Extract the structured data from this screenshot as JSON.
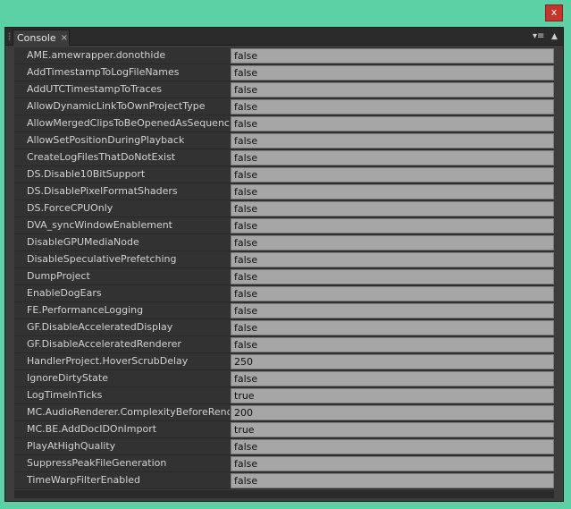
{
  "window": {
    "close_label": "x"
  },
  "panel": {
    "tab_label": "Console",
    "tab_close": "×",
    "menu_icon": "▾≡",
    "scroll_icon": "▲"
  },
  "settings": [
    {
      "name": "AME.amewrapper.donothide",
      "value": "false"
    },
    {
      "name": "AddTimestampToLogFileNames",
      "value": "false"
    },
    {
      "name": "AddUTCTimestampToTraces",
      "value": "false"
    },
    {
      "name": "AllowDynamicLinkToOwnProjectType",
      "value": "false"
    },
    {
      "name": "AllowMergedClipsToBeOpenedAsSequences",
      "value": "false"
    },
    {
      "name": "AllowSetPositionDuringPlayback",
      "value": "false"
    },
    {
      "name": "CreateLogFilesThatDoNotExist",
      "value": "false"
    },
    {
      "name": "DS.Disable10BitSupport",
      "value": "false"
    },
    {
      "name": "DS.DisablePixelFormatShaders",
      "value": "false"
    },
    {
      "name": "DS.ForceCPUOnly",
      "value": "false"
    },
    {
      "name": "DVA_syncWindowEnablement",
      "value": "false"
    },
    {
      "name": "DisableGPUMediaNode",
      "value": "false"
    },
    {
      "name": "DisableSpeculativePrefetching",
      "value": "false"
    },
    {
      "name": "DumpProject",
      "value": "false"
    },
    {
      "name": "EnableDogEars",
      "value": "false"
    },
    {
      "name": "FE.PerformanceLogging",
      "value": "false"
    },
    {
      "name": "GF.DisableAcceleratedDisplay",
      "value": "false"
    },
    {
      "name": "GF.DisableAcceleratedRenderer",
      "value": "false"
    },
    {
      "name": "HandlerProject.HoverScrubDelay",
      "value": "250"
    },
    {
      "name": "IgnoreDirtyState",
      "value": "false"
    },
    {
      "name": "LogTimeInTicks",
      "value": "true"
    },
    {
      "name": "MC.AudioRenderer.ComplexityBeforeRender",
      "value": "200"
    },
    {
      "name": "MC.BE.AddDocIDOnImport",
      "value": "true"
    },
    {
      "name": "PlayAtHighQuality",
      "value": "false"
    },
    {
      "name": "SuppressPeakFileGeneration",
      "value": "false"
    },
    {
      "name": "TimeWarpFilterEnabled",
      "value": "false"
    }
  ]
}
